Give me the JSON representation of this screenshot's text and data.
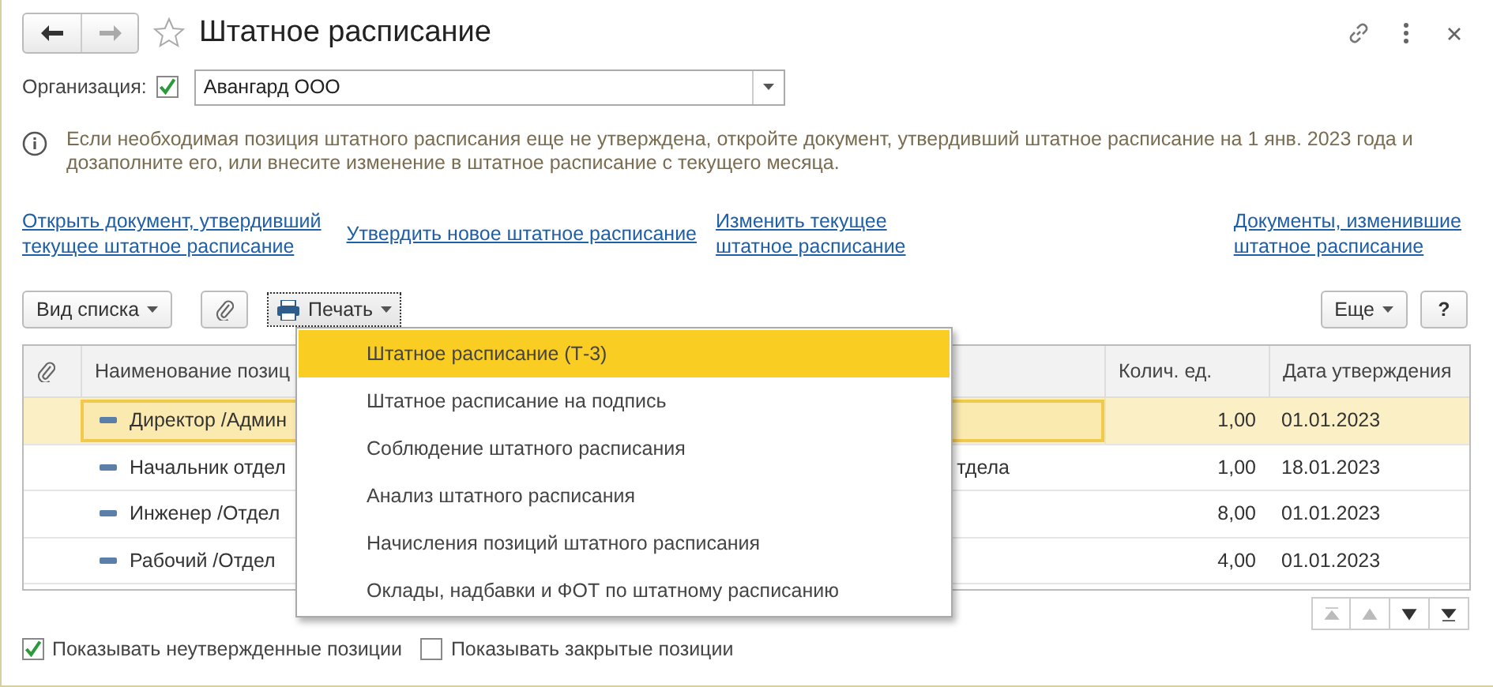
{
  "window": {
    "title": "Штатное расписание",
    "favorite": false
  },
  "organization": {
    "label": "Организация:",
    "checked": true,
    "value": "Авангард ООО"
  },
  "info": "Если необходимая позиция штатного расписания еще не утверждена, откройте документ, утвердивший штатное расписание на 1 янв. 2023 года и дозаполните его, или внесите изменение в штатное расписание с текущего месяца.",
  "links": [
    {
      "lines": [
        "Открыть документ, утвердивший",
        "текущее штатное расписание"
      ]
    },
    {
      "lines": [
        "Утвердить новое штатное расписание"
      ]
    },
    {
      "lines": [
        "Изменить текущее",
        "штатное расписание"
      ]
    },
    {
      "lines": [
        "Документы, изменившие",
        "штатное расписание"
      ]
    }
  ],
  "toolbar": {
    "list_view": "Вид списка",
    "print": "Печать",
    "more": "Еще",
    "help": "?"
  },
  "table": {
    "columns": [
      "Наименование позиц",
      "Колич. ед.",
      "Дата утверждения"
    ],
    "rows": [
      {
        "selected": true,
        "name": "Директор /Админ",
        "name_tail": "",
        "qty": "1,00",
        "date": "01.01.2023"
      },
      {
        "selected": false,
        "name": "Начальник отдел",
        "name_tail": "тдела",
        "qty": "1,00",
        "date": "18.01.2023"
      },
      {
        "selected": false,
        "name": "Инженер /Отдел",
        "name_tail": "",
        "qty": "8,00",
        "date": "01.01.2023"
      },
      {
        "selected": false,
        "name": "Рабочий /Отдел",
        "name_tail": "",
        "qty": "4,00",
        "date": "01.01.2023"
      }
    ]
  },
  "print_menu": [
    {
      "label": "Штатное расписание (Т-3)",
      "selected": true
    },
    {
      "label": "Штатное расписание на подпись",
      "selected": false
    },
    {
      "label": "Соблюдение штатного расписания",
      "selected": false
    },
    {
      "label": "Анализ штатного расписания",
      "selected": false
    },
    {
      "label": "Начисления позиций штатного расписания",
      "selected": false
    },
    {
      "label": "Оклады, надбавки и ФОТ по штатному расписанию",
      "selected": false
    }
  ],
  "options": [
    {
      "label": "Показывать неутвержденные позиции",
      "checked": true
    },
    {
      "label": "Показывать закрытые позиции",
      "checked": false
    }
  ]
}
